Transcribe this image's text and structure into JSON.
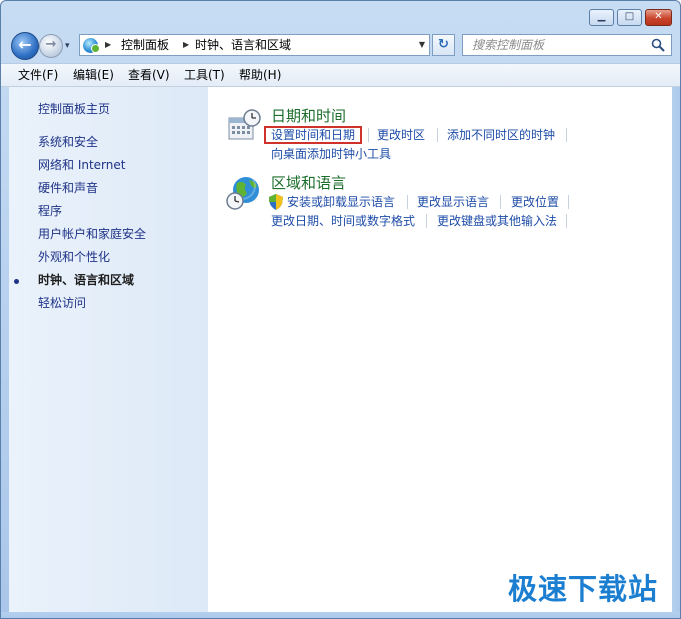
{
  "window": {
    "minimize": "▁",
    "maximize": "□",
    "close": "✕"
  },
  "nav": {
    "back": "←",
    "forward": "→",
    "history": "▾",
    "refresh": "↻",
    "breadcrumb": [
      "控制面板",
      "时钟、语言和区域"
    ],
    "search_placeholder": "搜索控制面板"
  },
  "menu": [
    "文件(F)",
    "编辑(E)",
    "查看(V)",
    "工具(T)",
    "帮助(H)"
  ],
  "sidebar": {
    "home": "控制面板主页",
    "items": [
      "系统和安全",
      "网络和 Internet",
      "硬件和声音",
      "程序",
      "用户帐户和家庭安全",
      "外观和个性化",
      "时钟、语言和区域",
      "轻松访问"
    ],
    "current_index": 6
  },
  "categories": [
    {
      "title": "日期和时间",
      "icon": "calendar-clock-icon",
      "tasks": [
        "设置时间和日期",
        "更改时区",
        "添加不同时区的时钟",
        "向桌面添加时钟小工具"
      ]
    },
    {
      "title": "区域和语言",
      "icon": "globe-clock-icon",
      "tasks": [
        "安装或卸载显示语言",
        "更改显示语言",
        "更改位置",
        "更改日期、时间或数字格式",
        "更改键盘或其他输入法"
      ]
    }
  ],
  "watermark": "极速下载站",
  "colors": {
    "accent": "#1c6e2c",
    "link": "#1e4ca8",
    "highlight_box": "#d0312a"
  }
}
